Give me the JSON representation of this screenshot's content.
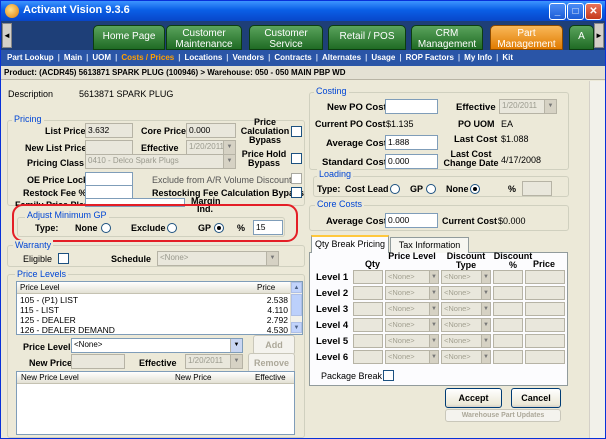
{
  "window": {
    "title": "Activant Vision 9.3.6",
    "minimize": "_",
    "maximize": "□",
    "close": "✕"
  },
  "tabs": [
    {
      "label": "Home Page"
    },
    {
      "label": "Customer Maintenance"
    },
    {
      "label": "Customer Service"
    },
    {
      "label": "Retail / POS"
    },
    {
      "label": "CRM Management"
    },
    {
      "label": "Part Management"
    },
    {
      "label": "A"
    }
  ],
  "subnav": [
    "Part Lookup",
    "Main",
    "UOM",
    "Costs / Prices",
    "Locations",
    "Vendors",
    "Contracts",
    "Alternates",
    "Usage",
    "ROP Factors",
    "My Info",
    "Kit"
  ],
  "breadcrumb": "Product: (ACDR45)  5613871 SPARK PLUG (100946) > Warehouse: 050 - 050 MAIN PBP WD",
  "description": {
    "label": "Description",
    "value": "5613871 SPARK PLUG"
  },
  "pricing": {
    "title": "Pricing",
    "list_price_label": "List Price",
    "list_price": "3.632",
    "core_price_label": "Core Price",
    "core_price": "0.000",
    "calc_bypass_label": "Price Calculation Bypass",
    "new_list_price_label": "New List Price",
    "effective_label": "Effective",
    "effective": "1/20/2011",
    "hold_bypass_label": "Price Hold Bypass",
    "pricing_class_label": "Pricing Class",
    "pricing_class": "0410 - Delco Spark Plugs",
    "oe_lock_label": "OE Price Lock",
    "exclude_ar_label": "Exclude from A/R Volume Discount",
    "restock_fee_label": "Restock Fee %",
    "restock_bypass_label": "Restocking Fee Calculation Bypass",
    "family_label": "Family Price Plan",
    "margin_label": "Margin Ind."
  },
  "adjust_gp": {
    "title": "Adjust Minimum GP",
    "type_label": "Type:",
    "none_label": "None",
    "exclude_label": "Exclude",
    "gp_label": "GP",
    "pct_label": "%",
    "pct_value": "15"
  },
  "warranty": {
    "title": "Warranty",
    "eligible_label": "Eligible",
    "schedule_label": "Schedule",
    "schedule_value": "<None>"
  },
  "price_levels": {
    "title": "Price Levels",
    "col_level": "Price Level",
    "col_price": "Price",
    "rows": [
      {
        "level": "105 - (P1) LIST",
        "price": "2.538"
      },
      {
        "level": "115 - LIST",
        "price": "4.110"
      },
      {
        "level": "125 - DEALER",
        "price": "2.792"
      },
      {
        "level": "126 - DEALER DEMAND",
        "price": "4.530"
      }
    ],
    "price_level_label": "Price Level",
    "price_level_value": "<None>",
    "add_label": "Add",
    "new_price_label": "New Price",
    "effective_label": "Effective",
    "effective_value": "1/20/2011",
    "remove_label": "Remove",
    "col_new_level": "New Price Level",
    "col_new_price": "New Price",
    "col_effective": "Effective"
  },
  "costing": {
    "title": "Costing",
    "new_po_label": "New PO Cost",
    "effective_label": "Effective",
    "effective_value": "1/20/2011",
    "current_po_label": "Current PO Cost",
    "current_po": "$1.135",
    "po_uom_label": "PO UOM",
    "po_uom": "EA",
    "avg_cost_label": "Average Cost",
    "avg_cost": "1.888",
    "last_cost_label": "Last Cost",
    "last_cost": "$1.088",
    "std_cost_label": "Standard Cost",
    "std_cost": "0.000",
    "last_cost_change_label": "Last Cost Change Date",
    "last_cost_change": "4/17/2008"
  },
  "loading": {
    "title": "Loading",
    "type_label": "Type:",
    "cost_lead_label": "Cost Lead",
    "gp_label": "GP",
    "none_label": "None",
    "pct_label": "%"
  },
  "core_costs": {
    "title": "Core Costs",
    "avg_label": "Average Cost",
    "avg_value": "0.000",
    "current_label": "Current Cost",
    "current_value": "$0.000"
  },
  "qty_break": {
    "tab_active": "Qty Break Pricing",
    "tab_other": "Tax Information",
    "col_qty": "Qty",
    "col_price_level": "Price Level",
    "col_discount_type": "Discount Type",
    "col_discount_pct": "Discount %",
    "col_price": "Price",
    "levels": [
      "Level 1",
      "Level 2",
      "Level 3",
      "Level 4",
      "Level 5",
      "Level 6"
    ],
    "none_value": "<None>",
    "package_break_label": "Package Break"
  },
  "buttons": {
    "accept": "Accept",
    "cancel": "Cancel",
    "warehouse_update": "Warehouse Part Updates"
  },
  "colors": {
    "accent_tab": "#e07b00",
    "tab_green": "#1f6b24",
    "nav_blue": "#2a55a7",
    "highlight": "#e41e26"
  }
}
